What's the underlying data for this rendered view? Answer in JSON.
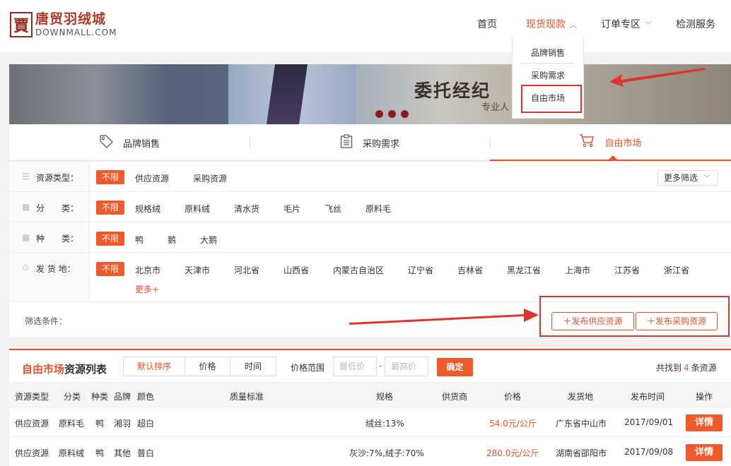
{
  "logo": {
    "mark": "賈",
    "cn": "唐贸羽绒城",
    "en": "DOWNMALL.COM"
  },
  "nav": {
    "home": "首页",
    "spot": "现货现款",
    "orders": "订单专区",
    "inspection": "检测服务"
  },
  "dropdown": {
    "items": [
      "品牌销售",
      "采购需求",
      "自由市场"
    ]
  },
  "banner": {
    "title": "委托经纪",
    "subtitle": "专业人"
  },
  "tabs": [
    "品牌销售",
    "采购需求",
    "自由市场"
  ],
  "filters": {
    "resource_type": {
      "label": "资源类型：",
      "options": [
        "不限",
        "供应资源",
        "采购资源"
      ],
      "more": "更多筛选"
    },
    "category": {
      "label": "分　　类：",
      "options": [
        "不限",
        "规格绒",
        "原料绒",
        "清水货",
        "毛片",
        "飞丝",
        "原料毛"
      ]
    },
    "species": {
      "label": "种　　类：",
      "options": [
        "不限",
        "鸭",
        "鹅",
        "大鹅"
      ]
    },
    "origin": {
      "label": "发 货 地：",
      "options": [
        "不限",
        "北京市",
        "天津市",
        "河北省",
        "山西省",
        "内蒙古自治区",
        "辽宁省",
        "吉林省",
        "黑龙江省",
        "上海市",
        "江苏省",
        "浙江省"
      ],
      "more": "更多+"
    },
    "conditions_label": "筛选条件：",
    "publish_supply": "发布供应资源",
    "publish_purchase": "发布采购资源"
  },
  "list": {
    "title_highlight": "自由市场",
    "title_rest": "资源列表",
    "sort": [
      "默认排序",
      "价格",
      "时间"
    ],
    "price_range_label": "价格范围",
    "min_placeholder": "最低价",
    "max_placeholder": "最高价",
    "dash": "-",
    "confirm": "确定",
    "found_prefix": "共找到",
    "found_count": "4",
    "found_suffix": "条资源",
    "headers": [
      "资源类型",
      "分类",
      "种类",
      "品牌",
      "颜色",
      "质量标准",
      "规格",
      "供货商",
      "价格",
      "发货地",
      "发布时间",
      "操作"
    ],
    "rows": [
      {
        "type": "供应资源",
        "category": "原料毛",
        "species": "鸭",
        "brand": "湘羽",
        "color": "超白",
        "standard": "",
        "spec": "绒丝:13%",
        "supplier": "",
        "price": "54.0元/公斤",
        "origin": "广东省中山市",
        "date": "2017/09/01",
        "action": "详情"
      },
      {
        "type": "供应资源",
        "category": "原料绒",
        "species": "鸭",
        "brand": "其他",
        "color": "普白",
        "standard": "",
        "spec": "灰沙:7%,绒子:70%",
        "supplier": "",
        "price": "280.0元/公斤",
        "origin": "湖南省邵阳市",
        "date": "2017/09/08",
        "action": "详情"
      }
    ]
  },
  "colors": {
    "accent": "#e8502b",
    "annotation": "#e0332d"
  }
}
